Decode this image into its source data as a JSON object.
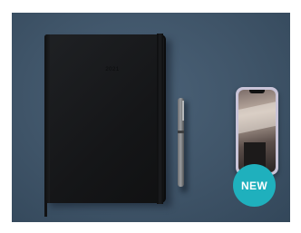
{
  "notebook": {
    "year": "2021"
  },
  "badge": {
    "label": "NEW",
    "color": "#1fb0bd"
  },
  "colors": {
    "background": "#3f5468",
    "notebook": "#151618"
  }
}
